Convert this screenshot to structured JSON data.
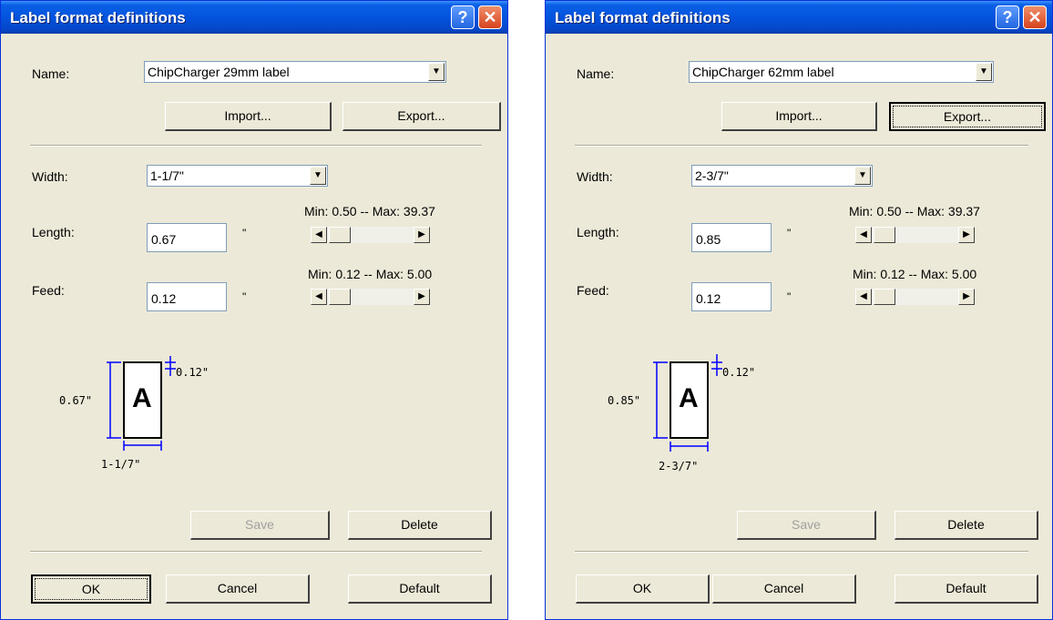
{
  "dialogs": [
    {
      "title": "Label format definitions",
      "name_label": "Name:",
      "name_value": "ChipCharger 29mm label",
      "import_label": "Import...",
      "export_label": "Export...",
      "width_label": "Width:",
      "width_value": "1-1/7\"",
      "length_label": "Length:",
      "length_value": "0.67",
      "length_unit": "\"",
      "length_range": "Min: 0.50 -- Max: 39.37",
      "feed_label": "Feed:",
      "feed_value": "0.12",
      "feed_unit": "\"",
      "feed_range": "Min: 0.12 -- Max: 5.00",
      "preview": {
        "letter": "A",
        "length": "0.67\"",
        "feed": "0.12\"",
        "width": "1-1/7\""
      },
      "save_label": "Save",
      "delete_label": "Delete",
      "ok_label": "OK",
      "cancel_label": "Cancel",
      "default_label": "Default"
    },
    {
      "title": "Label format definitions",
      "name_label": "Name:",
      "name_value": "ChipCharger 62mm label",
      "import_label": "Import...",
      "export_label": "Export...",
      "width_label": "Width:",
      "width_value": "2-3/7\"",
      "length_label": "Length:",
      "length_value": "0.85",
      "length_unit": "\"",
      "length_range": "Min: 0.50 -- Max: 39.37",
      "feed_label": "Feed:",
      "feed_value": "0.12",
      "feed_unit": "\"",
      "feed_range": "Min: 0.12 -- Max: 5.00",
      "preview": {
        "letter": "A",
        "length": "0.85\"",
        "feed": "0.12\"",
        "width": "2-3/7\""
      },
      "save_label": "Save",
      "delete_label": "Delete",
      "ok_label": "OK",
      "cancel_label": "Cancel",
      "default_label": "Default"
    }
  ],
  "icons": {
    "help": "question-mark-icon",
    "close": "close-x-icon",
    "dropdown": "chevron-down-icon",
    "scroll_left": "arrow-left-icon",
    "scroll_right": "arrow-right-icon"
  },
  "colors": {
    "titlebar": "#0454de",
    "window_face": "#ece9d8",
    "dimension_lines": "#0000ff",
    "close_button": "#d6431e"
  }
}
